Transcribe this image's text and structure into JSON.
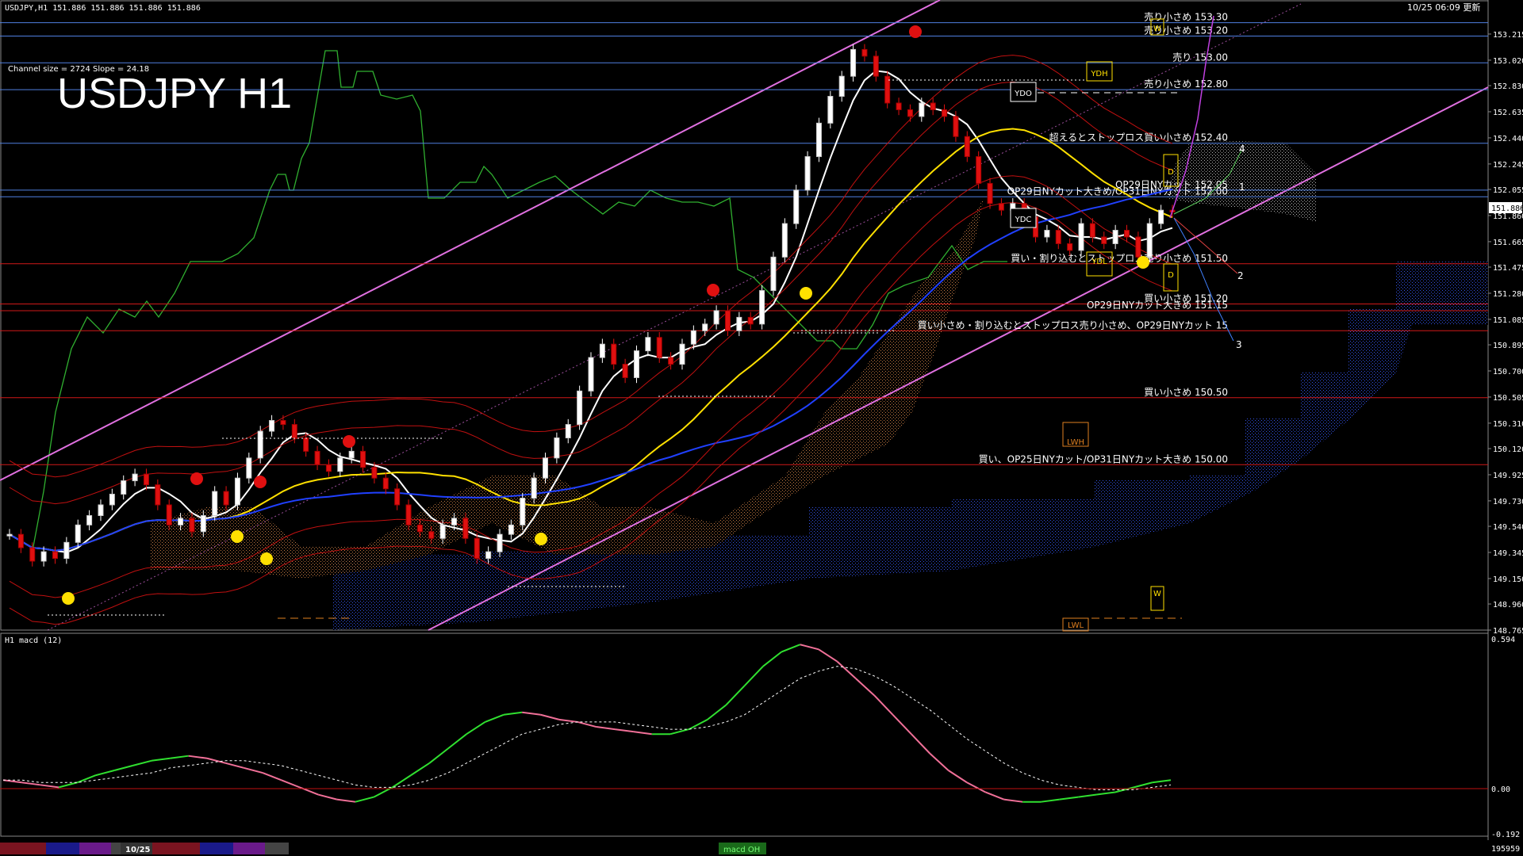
{
  "header": {
    "symbol_line": "USDJPY,H1  151.886 151.886 151.886 151.886",
    "timestamp": "10/25 06:09 更新",
    "channel_info": "Channel size = 2724 Slope = 24.18",
    "big_title": "USDJPY H1"
  },
  "price_axis": {
    "ticks": [
      "153.215",
      "153.020",
      "152.830",
      "152.635",
      "152.440",
      "152.245",
      "152.055",
      "151.860",
      "151.665",
      "151.475",
      "151.280",
      "151.085",
      "150.895",
      "150.700",
      "150.505",
      "150.310",
      "150.120",
      "149.925",
      "149.730",
      "149.540",
      "149.345",
      "149.150",
      "148.960",
      "148.765"
    ],
    "current_price": "151.886"
  },
  "levels": [
    {
      "price": 153.3,
      "label": "売り小さめ 153.30",
      "color": "#4f7fe0"
    },
    {
      "price": 153.2,
      "label": "売り小さめ 153.20",
      "color": "#4f7fe0"
    },
    {
      "price": 153.0,
      "label": "売り 153.00",
      "color": "#4f7fe0"
    },
    {
      "price": 152.8,
      "label": "売り小さめ 152.80",
      "color": "#4f7fe0"
    },
    {
      "price": 152.4,
      "label": "超えるとストップロス買い小さめ 152.40",
      "color": "#4f7fe0"
    },
    {
      "price": 152.05,
      "label": "OP29日NYカット 152.05",
      "color": "#4f7fe0"
    },
    {
      "price": 152.0,
      "label": "OP29日NYカット大きめ/OP31日NYカット 152.00",
      "color": "#4f7fe0"
    },
    {
      "price": 151.5,
      "label": "買い・割り込むとストップロス売り小さめ 151.50",
      "color": "#d01818"
    },
    {
      "price": 151.2,
      "label": "買い小さめ 151.20",
      "color": "#d01818"
    },
    {
      "price": 151.15,
      "label": "OP29日NYカット大きめ 151.15",
      "color": "#d01818"
    },
    {
      "price": 151.0,
      "label": "買い小さめ・割り込むとストップロス売り小さめ、OP29日NYカット 15",
      "color": "#d01818"
    },
    {
      "price": 150.5,
      "label": "買い小さめ 150.50",
      "color": "#d01818"
    },
    {
      "price": 150.0,
      "label": "買い、OP25日NYカット/OP31日NYカット大きめ 150.00",
      "color": "#d01818"
    }
  ],
  "box_labels": {
    "ydh": "YDH",
    "ydo": "YDO",
    "ydc": "YDC",
    "ydl": "YDL",
    "lwh": "LWH",
    "lwl": "LWL",
    "w1": "W",
    "w2": "W",
    "d1": "D",
    "d2": "D",
    "wave_4": "4",
    "wave_1": "1",
    "wave_2": "2",
    "wave_3": "3"
  },
  "macd": {
    "label": "H1  macd (12)",
    "ticks": [
      "0.594",
      "0.00",
      "-0.192"
    ]
  },
  "bottom_bar": {
    "date_label": "10/25",
    "macd_tab": "macd OH",
    "counter": "195959"
  },
  "colors": {
    "bull": "#ffffff",
    "bear": "#e01010",
    "sma_white": "#ffffff",
    "sma_yellow": "#ffe000",
    "sma_blue": "#2040ff",
    "channel": "#e070e0",
    "lagging": "#30c030",
    "macd_up": "#30e030",
    "macd_down": "#f07098",
    "signal": "#ffffff"
  },
  "chart_data": {
    "type": "line",
    "title": "USDJPY H1",
    "xlabel": "",
    "ylabel": "",
    "ylim": [
      148.765,
      153.41
    ],
    "series": [
      {
        "name": "USDJPY,H1",
        "values": [
          149.48,
          149.38,
          149.28,
          149.35,
          149.3,
          149.42,
          149.55,
          149.62,
          149.7,
          149.78,
          149.88,
          149.93,
          149.85,
          149.7,
          149.55,
          149.6,
          149.5,
          149.62,
          149.8,
          149.7,
          149.9,
          150.05,
          150.25,
          150.33,
          150.3,
          150.2,
          150.1,
          150.0,
          149.95,
          150.05,
          150.1,
          149.98,
          149.9,
          149.82,
          149.7,
          149.55,
          149.5,
          149.45,
          149.55,
          149.6,
          149.45,
          149.3,
          149.35,
          149.48,
          149.55,
          149.75,
          149.9,
          150.05,
          150.2,
          150.3,
          150.55,
          150.8,
          150.9,
          150.75,
          150.65,
          150.85,
          150.95,
          150.8,
          150.75,
          150.9,
          151.0,
          151.05,
          151.15,
          151.0,
          151.1,
          151.05,
          151.3,
          151.55,
          151.8,
          152.05,
          152.3,
          152.55,
          152.75,
          152.9,
          153.1,
          153.05,
          152.9,
          152.7,
          152.65,
          152.6,
          152.7,
          152.65,
          152.6,
          152.45,
          152.3,
          152.1,
          151.95,
          151.9,
          151.95,
          151.85,
          151.7,
          151.75,
          151.65,
          151.6,
          151.8,
          151.7,
          151.65,
          151.75,
          151.7,
          151.55,
          151.8,
          151.9,
          151.886
        ]
      }
    ],
    "macd_ylim": [
      -0.192,
      0.594
    ],
    "macd_line": [
      0.03,
      0.02,
      0.01,
      0.0,
      0.02,
      0.05,
      0.07,
      0.09,
      0.11,
      0.12,
      0.13,
      0.12,
      0.1,
      0.08,
      0.06,
      0.03,
      0.0,
      -0.03,
      -0.05,
      -0.06,
      -0.04,
      0.0,
      0.05,
      0.1,
      0.16,
      0.22,
      0.27,
      0.3,
      0.31,
      0.3,
      0.28,
      0.27,
      0.25,
      0.24,
      0.23,
      0.22,
      0.22,
      0.24,
      0.28,
      0.34,
      0.42,
      0.5,
      0.56,
      0.59,
      0.57,
      0.52,
      0.45,
      0.38,
      0.3,
      0.22,
      0.14,
      0.07,
      0.02,
      -0.02,
      -0.05,
      -0.06,
      -0.06,
      -0.05,
      -0.04,
      -0.03,
      -0.02,
      0.0,
      0.02,
      0.03
    ],
    "signal_line": [
      0.03,
      0.03,
      0.02,
      0.02,
      0.02,
      0.03,
      0.04,
      0.05,
      0.06,
      0.08,
      0.09,
      0.1,
      0.11,
      0.11,
      0.1,
      0.09,
      0.07,
      0.05,
      0.03,
      0.01,
      0.0,
      0.0,
      0.01,
      0.03,
      0.06,
      0.1,
      0.14,
      0.18,
      0.22,
      0.24,
      0.26,
      0.27,
      0.27,
      0.27,
      0.26,
      0.25,
      0.24,
      0.24,
      0.25,
      0.27,
      0.3,
      0.35,
      0.4,
      0.45,
      0.48,
      0.5,
      0.49,
      0.46,
      0.42,
      0.37,
      0.32,
      0.26,
      0.2,
      0.15,
      0.1,
      0.06,
      0.03,
      0.01,
      0.0,
      -0.01,
      -0.01,
      -0.01,
      0.0,
      0.01
    ]
  }
}
